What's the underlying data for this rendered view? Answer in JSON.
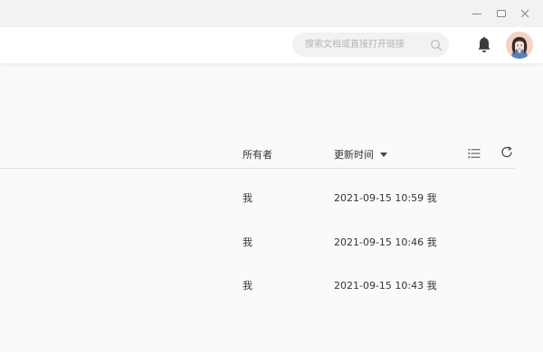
{
  "window": {
    "minimize_icon": "minimize-icon",
    "maximize_icon": "maximize-icon",
    "close_icon": "close-icon"
  },
  "header": {
    "search": {
      "placeholder": "搜索文档或直接打开链接",
      "value": ""
    },
    "icons": [
      "search-icon",
      "bell-icon",
      "avatar"
    ]
  },
  "table": {
    "columns": {
      "owner": "所有者",
      "updated": "更新时间"
    },
    "sort": "更新时间 descending",
    "rows": [
      {
        "owner": "我",
        "updated": "2021-09-15 10:59 我"
      },
      {
        "owner": "我",
        "updated": "2021-09-15 10:46 我"
      },
      {
        "owner": "我",
        "updated": "2021-09-15 10:43 我"
      }
    ]
  },
  "colors": {
    "titlebar_bg": "#f1f2f4",
    "header_bg": "#ffffff",
    "page_bg": "#fafafa",
    "search_bg": "#f1f2f4",
    "text": "#333333",
    "placeholder": "#b3b3b3"
  }
}
